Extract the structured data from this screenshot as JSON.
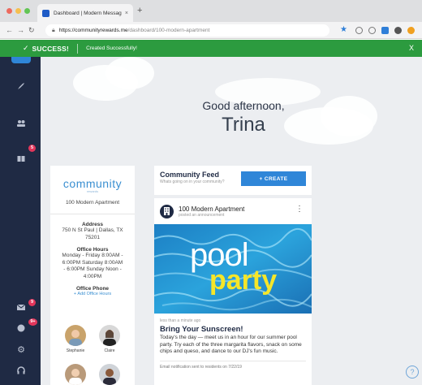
{
  "browser": {
    "tab_title": "Dashboard | Modern Message",
    "tab_close": "×",
    "new_tab": "+",
    "url_host": "https://communityrewards.me",
    "url_path": "/dashboard/100-modern-apartment"
  },
  "banner": {
    "check": "✓",
    "title": "SUCCESS!",
    "message": "Created Successfully!",
    "close": "X"
  },
  "sidebar": {
    "badges": [
      "5",
      "9",
      "9+"
    ]
  },
  "greeting": {
    "line": "Good afternoon,",
    "name": "Trina"
  },
  "property": {
    "logo": "community",
    "logo_sub": "rewards",
    "name": "100 Modern Apartment",
    "address_label": "Address",
    "address_line1": "750 N St Paul | Dallas, TX",
    "address_line2": "75201",
    "hours_label": "Office Hours",
    "hours_lines": [
      "Monday - Friday 8:00AM -",
      "6:00PM Saturday 8:00AM",
      "- 6:00PM Sunday Noon -",
      "4:00PM"
    ],
    "phone_label": "Office Phone",
    "phone_link": "+ Add Office Hours",
    "staff": [
      "Stephanie",
      "Claire"
    ]
  },
  "feed": {
    "title": "Community Feed",
    "subtitle": "Whats going on in your community?",
    "create_label": "+ CREATE"
  },
  "post": {
    "author": "100 Modern Apartment",
    "action": "posted an announcement",
    "image_word1": "pool",
    "image_word2": "party",
    "time": "less than a minute ago",
    "headline": "Bring Your Sunscreen!",
    "body": "Today's the day — meet us in an hour for our summer pool party. Try each of the three margarita flavors, snack on some chips and queso, and dance to our DJ's fun music.",
    "notification": "Email notification sent to residents on 7/22/19"
  },
  "help": "?",
  "colors": {
    "success": "#2c9b3f",
    "sidebar": "#1f2a44",
    "accent": "#2f86d8",
    "badge": "#e2365b"
  }
}
